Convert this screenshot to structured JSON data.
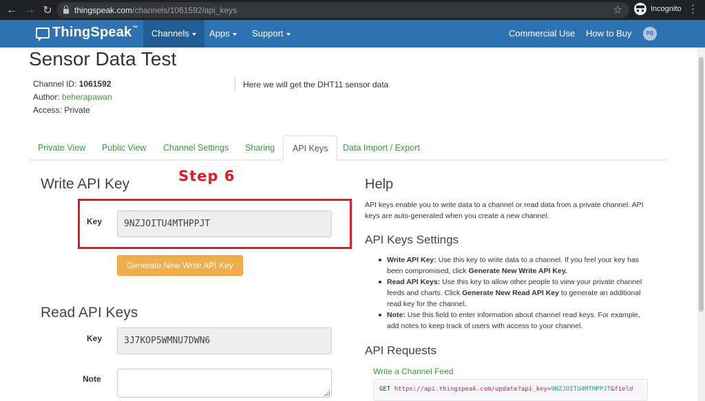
{
  "browser": {
    "url_host": "thingspeak.com",
    "url_path": "/channels/1061592/api_keys",
    "incognito_label": "Incognito",
    "icons": [
      "back-arrow-icon",
      "forward-arrow-icon",
      "reload-icon",
      "lock-icon",
      "star-icon",
      "incognito-icon",
      "kebab-menu-icon"
    ]
  },
  "navbar": {
    "logo": "ThingSpeak",
    "logo_tm": "™",
    "items": [
      "Channels",
      "Apps",
      "Support"
    ],
    "right_items": [
      "Commercial Use",
      "How to Buy"
    ],
    "avatar_initials": "PB",
    "color": "#2d73b3"
  },
  "channel": {
    "title": "Sensor Data Test",
    "id_label": "Channel ID:",
    "id_value": "1061592",
    "author_label": "Author:",
    "author_value": "beherapawan",
    "access_label": "Access:",
    "access_value": "Private",
    "description": "Here we will get the DHT11 sensor data"
  },
  "tabs": [
    "Private View",
    "Public View",
    "Channel Settings",
    "Sharing",
    "API Keys",
    "Data Import / Export"
  ],
  "active_tab": "API Keys",
  "write_section": {
    "heading": "Write API Key",
    "annotation": "Step 6",
    "key_label": "Key",
    "key_value": "9NZJOITU4MTHPPJT",
    "button_label": "Generate New Write API Key"
  },
  "read_section": {
    "heading": "Read API Keys",
    "key_label": "Key",
    "key_value": "3J7KOP5WMNU7DWN6",
    "note_label": "Note"
  },
  "help": {
    "heading": "Help",
    "paragraph": "API keys enable you to write data to a channel or read data from a private channel. API keys are auto-generated when you create a new channel.",
    "settings_heading": "API Keys Settings",
    "bullets": [
      {
        "title": "Write API Key:",
        "text_a": " Use this key to write data to a channel. If you feel your key has been compromised, click ",
        "bold": "Generate New Write API Key.",
        "text_b": ""
      },
      {
        "title": "Read API Keys:",
        "text_a": " Use this key to allow other people to view your private channel feeds and charts. Click ",
        "bold": "Generate New Read API Key",
        "text_b": " to generate an additional read key for the channel."
      },
      {
        "title": "Note:",
        "text_a": " Use this field to enter information about channel read keys. For example, add notes to keep track of users with access to your channel.",
        "bold": "",
        "text_b": ""
      }
    ],
    "requests_heading": "API Requests",
    "feed_link": "Write a Channel Feed",
    "code_method": "GET ",
    "code_url": "https://api.thingspeak.com/update?api_key=",
    "code_key": "9NZJOITU4MTHPPJT",
    "code_tail": "&field"
  }
}
